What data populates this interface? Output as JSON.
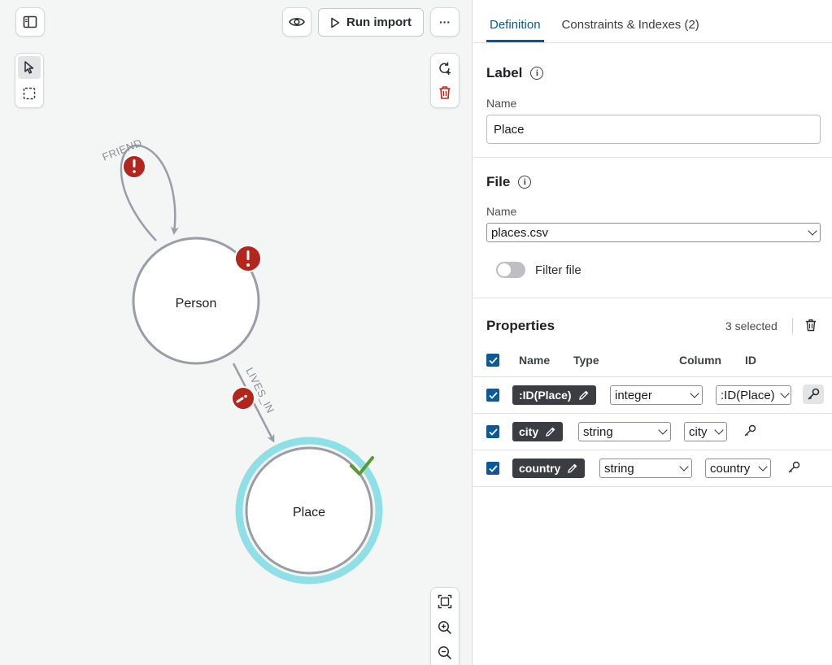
{
  "toolbar": {
    "run_import_label": "Run import",
    "more_label": "···"
  },
  "graph": {
    "nodes": [
      {
        "label": "Person"
      },
      {
        "label": "Place"
      }
    ],
    "relationships": [
      {
        "label": "FRIEND"
      },
      {
        "label": "LIVES_IN"
      }
    ],
    "colors": {
      "selected_ring": "#8fe0e6",
      "error": "#b3261e",
      "valid": "#5a9a2e",
      "edge": "#9a9da3"
    }
  },
  "panel": {
    "tabs": [
      {
        "label": "Definition"
      },
      {
        "label": "Constraints & Indexes (2)"
      }
    ],
    "label_section": {
      "title": "Label",
      "name_label": "Name",
      "name_value": "Place"
    },
    "file_section": {
      "title": "File",
      "name_label": "Name",
      "file_value": "places.csv",
      "filter_label": "Filter file"
    },
    "properties": {
      "title": "Properties",
      "selected_text": "3 selected",
      "columns": {
        "name": "Name",
        "type": "Type",
        "column": "Column",
        "id": "ID"
      },
      "rows": [
        {
          "name": ":ID(Place)",
          "type": "integer",
          "column": ":ID(Place)",
          "is_id": true
        },
        {
          "name": "city",
          "type": "string",
          "column": "city",
          "is_id": false
        },
        {
          "name": "country",
          "type": "string",
          "column": "country",
          "is_id": false
        }
      ]
    }
  }
}
